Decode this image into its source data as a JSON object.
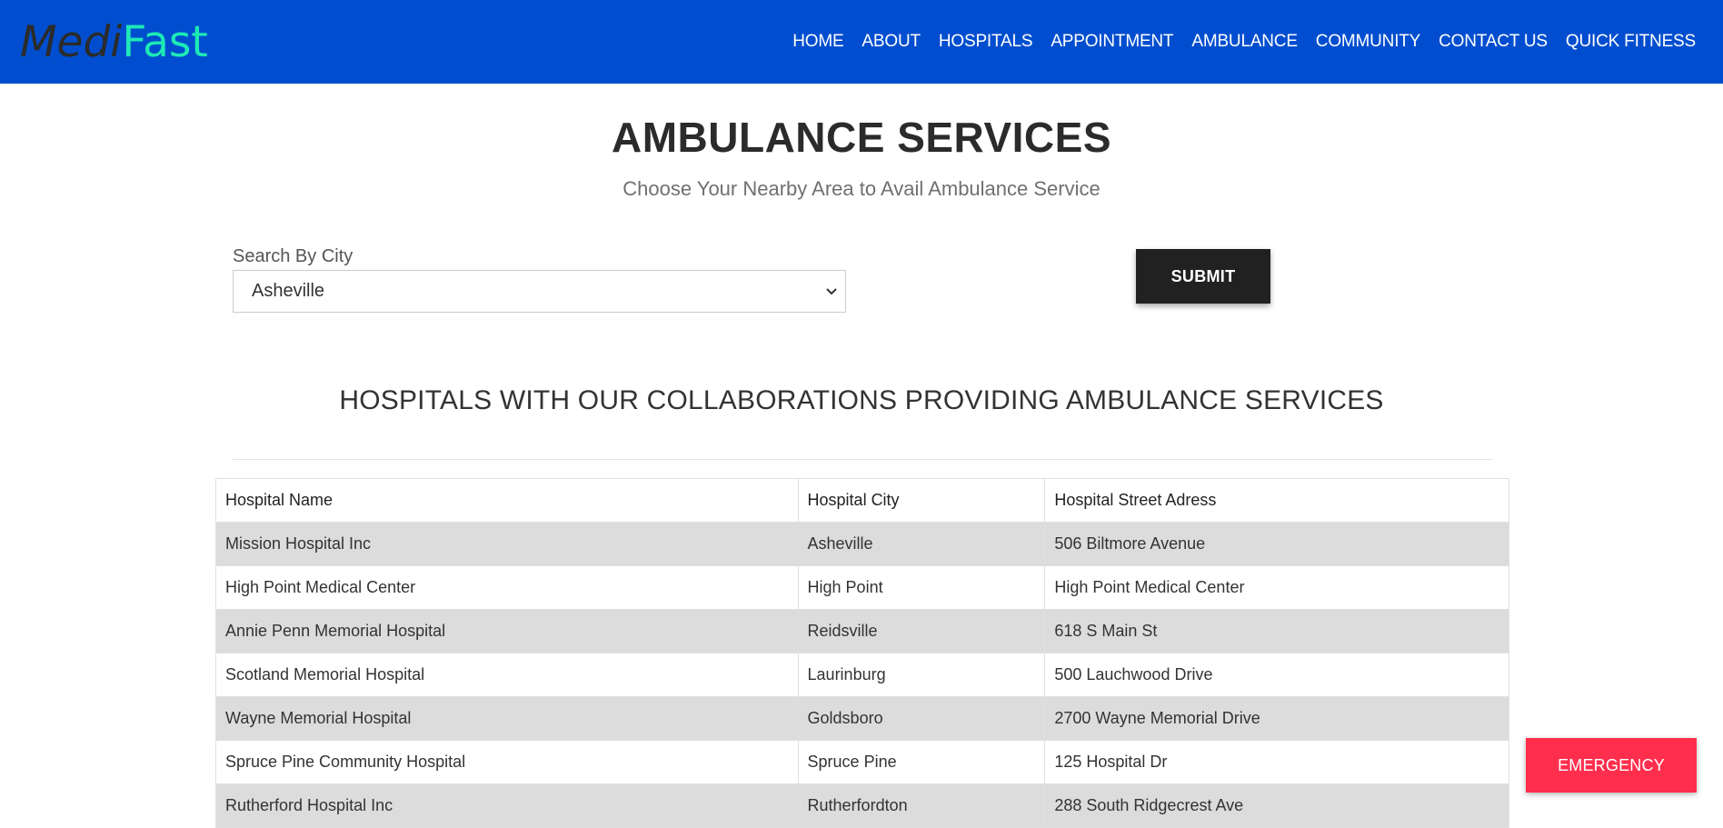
{
  "brand": {
    "part1": "Medi",
    "part2": "Fast"
  },
  "nav": [
    "HOME",
    "ABOUT",
    "HOSPITALS",
    "APPOINTMENT",
    "AMBULANCE",
    "COMMUNITY",
    "CONTACT US",
    "QUICK FITNESS"
  ],
  "page": {
    "title": "AMBULANCE SERVICES",
    "subtitle": "Choose Your Nearby Area to Avail Ambulance Service"
  },
  "search": {
    "label": "Search By City",
    "selected": "Asheville",
    "submit_label": "SUBMIT"
  },
  "section": {
    "heading": "HOSPITALS WITH OUR COLLABORATIONS PROVIDING AMBULANCE SERVICES"
  },
  "table": {
    "headers": [
      "Hospital Name",
      "Hospital City",
      "Hospital Street Adress"
    ],
    "rows": [
      [
        "Mission Hospital Inc",
        "Asheville",
        "506 Biltmore Avenue"
      ],
      [
        "High Point Medical Center",
        "High Point",
        "High Point Medical Center"
      ],
      [
        "Annie Penn Memorial Hospital",
        "Reidsville",
        "618 S Main St"
      ],
      [
        "Scotland Memorial Hospital",
        "Laurinburg",
        "500 Lauchwood Drive"
      ],
      [
        "Wayne Memorial Hospital",
        "Goldsboro",
        "2700 Wayne Memorial Drive"
      ],
      [
        "Spruce Pine Community Hospital",
        "Spruce Pine",
        "125 Hospital Dr"
      ],
      [
        "Rutherford Hospital Inc",
        "Rutherfordton",
        "288 South Ridgecrest Ave"
      ]
    ]
  },
  "emergency_label": "EMERGENCY",
  "colors": {
    "navbar": "#004ecf",
    "brand_accent": "#1de9b6",
    "submit": "#212121",
    "emergency": "#ff2e4d",
    "row_shade": "#dcdcdc"
  }
}
